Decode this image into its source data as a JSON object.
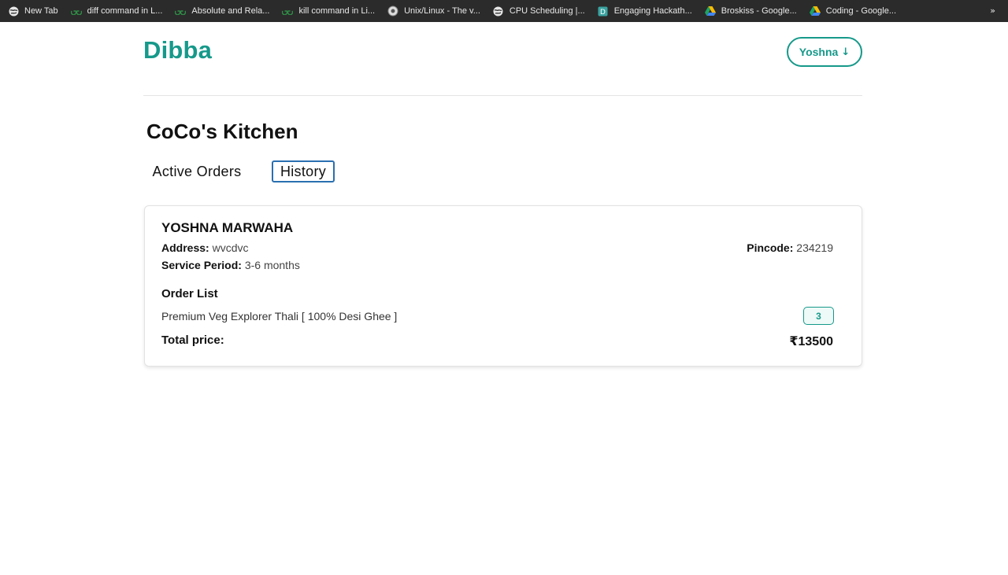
{
  "bookmarks_bar": {
    "items": [
      {
        "label": "New Tab",
        "icon": "globe-icon"
      },
      {
        "label": "diff command in L...",
        "icon": "geeksforgeeks-icon"
      },
      {
        "label": "Absolute and Rela...",
        "icon": "geeksforgeeks-icon"
      },
      {
        "label": "kill command in Li...",
        "icon": "geeksforgeeks-icon"
      },
      {
        "label": "Unix/Linux - The v...",
        "icon": "tutorialspoint-icon"
      },
      {
        "label": "CPU Scheduling |...",
        "icon": "globe-icon"
      },
      {
        "label": "Engaging Hackath...",
        "icon": "devfolio-icon"
      },
      {
        "label": "Broskiss - Google...",
        "icon": "google-drive-icon"
      },
      {
        "label": "Coding - Google...",
        "icon": "google-drive-icon"
      }
    ],
    "more": "»"
  },
  "header": {
    "logo": "Dibba",
    "user_button": "Yoshna",
    "user_arrow": "↓"
  },
  "page": {
    "title": "CoCo's Kitchen",
    "tabs": [
      "Active Orders",
      "History"
    ],
    "active_tab": "History"
  },
  "order": {
    "customer_name": "YOSHNA MARWAHA",
    "address_label": "Address:",
    "address_value": "wvcdvc",
    "period_label": "Service Period:",
    "period_value": "3-6 months",
    "pincode_label": "Pincode:",
    "pincode_value": "234219",
    "order_list_heading": "Order List",
    "items": [
      {
        "name": "Premium Veg Explorer Thali [ 100% Desi Ghee ]",
        "quantity": "3"
      }
    ],
    "total_label": "Total price:",
    "total_currency": "₹",
    "total_value": "13500"
  },
  "colors": {
    "brand": "#16998a",
    "active_tab_border": "#2a6fb0",
    "bookmarks_bg": "#2b2b2b"
  }
}
